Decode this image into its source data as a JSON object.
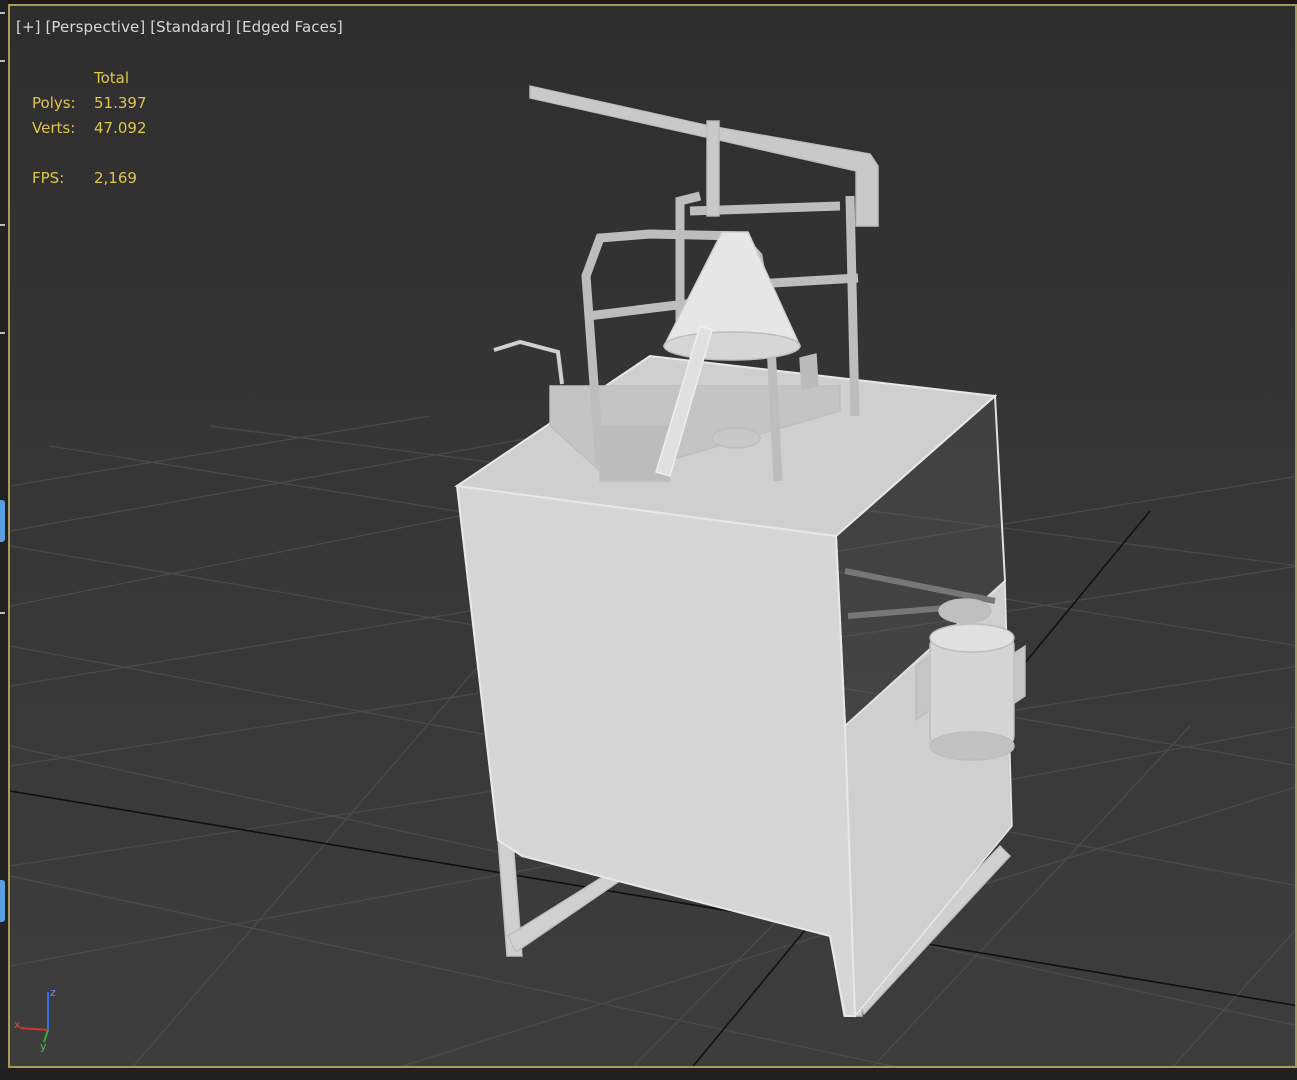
{
  "viewport": {
    "labels": [
      "[+]",
      "[Perspective]",
      "[Standard]",
      "[Edged Faces]"
    ]
  },
  "stats": {
    "header": "Total",
    "polys_label": "Polys:",
    "polys_value": "51.397",
    "verts_label": "Verts:",
    "verts_value": "47.092",
    "fps_label": "FPS:",
    "fps_value": "2,169"
  },
  "axis": {
    "x": "x",
    "y": "y",
    "z": "z"
  },
  "colors": {
    "stats_text": "#e1c64a",
    "viewport_border": "#a89a5a",
    "grid": "#4a4a4a",
    "model": "#d9d9d9"
  }
}
